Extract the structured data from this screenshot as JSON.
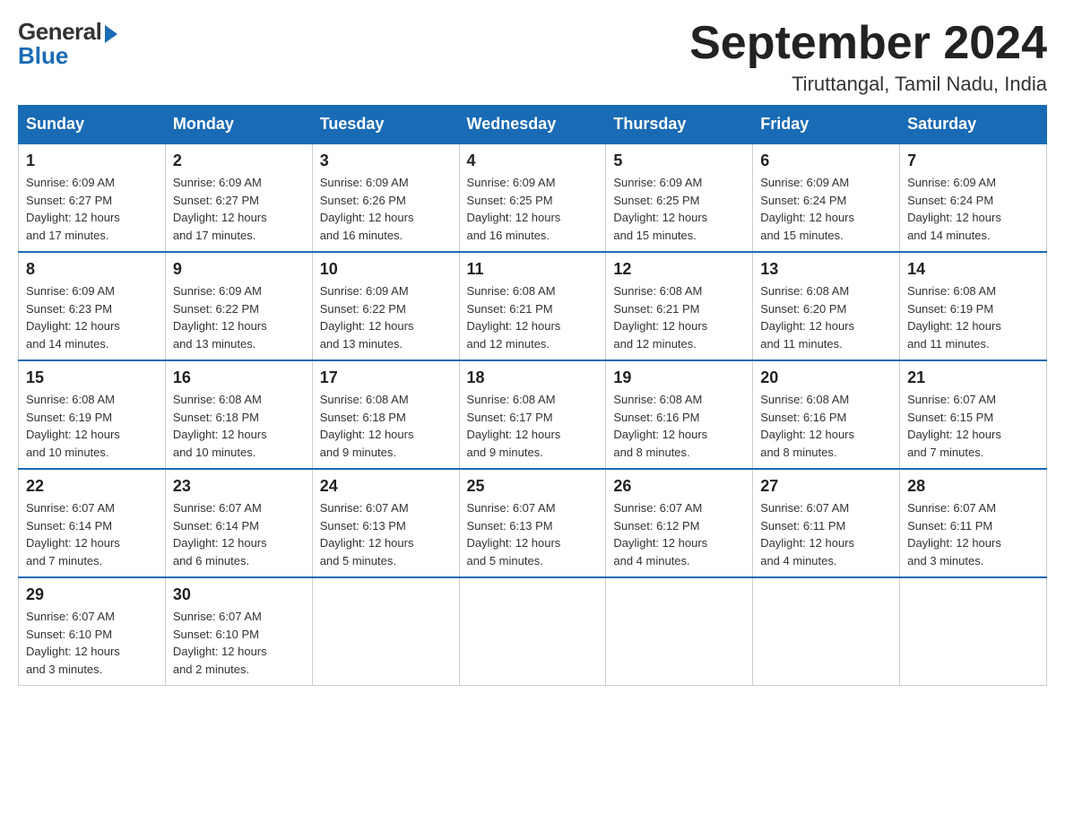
{
  "logo": {
    "general": "General",
    "blue": "Blue"
  },
  "header": {
    "title": "September 2024",
    "subtitle": "Tiruttangal, Tamil Nadu, India"
  },
  "weekdays": [
    "Sunday",
    "Monday",
    "Tuesday",
    "Wednesday",
    "Thursday",
    "Friday",
    "Saturday"
  ],
  "weeks": [
    [
      {
        "day": "1",
        "sunrise": "6:09 AM",
        "sunset": "6:27 PM",
        "daylight": "12 hours and 17 minutes."
      },
      {
        "day": "2",
        "sunrise": "6:09 AM",
        "sunset": "6:27 PM",
        "daylight": "12 hours and 17 minutes."
      },
      {
        "day": "3",
        "sunrise": "6:09 AM",
        "sunset": "6:26 PM",
        "daylight": "12 hours and 16 minutes."
      },
      {
        "day": "4",
        "sunrise": "6:09 AM",
        "sunset": "6:25 PM",
        "daylight": "12 hours and 16 minutes."
      },
      {
        "day": "5",
        "sunrise": "6:09 AM",
        "sunset": "6:25 PM",
        "daylight": "12 hours and 15 minutes."
      },
      {
        "day": "6",
        "sunrise": "6:09 AM",
        "sunset": "6:24 PM",
        "daylight": "12 hours and 15 minutes."
      },
      {
        "day": "7",
        "sunrise": "6:09 AM",
        "sunset": "6:24 PM",
        "daylight": "12 hours and 14 minutes."
      }
    ],
    [
      {
        "day": "8",
        "sunrise": "6:09 AM",
        "sunset": "6:23 PM",
        "daylight": "12 hours and 14 minutes."
      },
      {
        "day": "9",
        "sunrise": "6:09 AM",
        "sunset": "6:22 PM",
        "daylight": "12 hours and 13 minutes."
      },
      {
        "day": "10",
        "sunrise": "6:09 AM",
        "sunset": "6:22 PM",
        "daylight": "12 hours and 13 minutes."
      },
      {
        "day": "11",
        "sunrise": "6:08 AM",
        "sunset": "6:21 PM",
        "daylight": "12 hours and 12 minutes."
      },
      {
        "day": "12",
        "sunrise": "6:08 AM",
        "sunset": "6:21 PM",
        "daylight": "12 hours and 12 minutes."
      },
      {
        "day": "13",
        "sunrise": "6:08 AM",
        "sunset": "6:20 PM",
        "daylight": "12 hours and 11 minutes."
      },
      {
        "day": "14",
        "sunrise": "6:08 AM",
        "sunset": "6:19 PM",
        "daylight": "12 hours and 11 minutes."
      }
    ],
    [
      {
        "day": "15",
        "sunrise": "6:08 AM",
        "sunset": "6:19 PM",
        "daylight": "12 hours and 10 minutes."
      },
      {
        "day": "16",
        "sunrise": "6:08 AM",
        "sunset": "6:18 PM",
        "daylight": "12 hours and 10 minutes."
      },
      {
        "day": "17",
        "sunrise": "6:08 AM",
        "sunset": "6:18 PM",
        "daylight": "12 hours and 9 minutes."
      },
      {
        "day": "18",
        "sunrise": "6:08 AM",
        "sunset": "6:17 PM",
        "daylight": "12 hours and 9 minutes."
      },
      {
        "day": "19",
        "sunrise": "6:08 AM",
        "sunset": "6:16 PM",
        "daylight": "12 hours and 8 minutes."
      },
      {
        "day": "20",
        "sunrise": "6:08 AM",
        "sunset": "6:16 PM",
        "daylight": "12 hours and 8 minutes."
      },
      {
        "day": "21",
        "sunrise": "6:07 AM",
        "sunset": "6:15 PM",
        "daylight": "12 hours and 7 minutes."
      }
    ],
    [
      {
        "day": "22",
        "sunrise": "6:07 AM",
        "sunset": "6:14 PM",
        "daylight": "12 hours and 7 minutes."
      },
      {
        "day": "23",
        "sunrise": "6:07 AM",
        "sunset": "6:14 PM",
        "daylight": "12 hours and 6 minutes."
      },
      {
        "day": "24",
        "sunrise": "6:07 AM",
        "sunset": "6:13 PM",
        "daylight": "12 hours and 5 minutes."
      },
      {
        "day": "25",
        "sunrise": "6:07 AM",
        "sunset": "6:13 PM",
        "daylight": "12 hours and 5 minutes."
      },
      {
        "day": "26",
        "sunrise": "6:07 AM",
        "sunset": "6:12 PM",
        "daylight": "12 hours and 4 minutes."
      },
      {
        "day": "27",
        "sunrise": "6:07 AM",
        "sunset": "6:11 PM",
        "daylight": "12 hours and 4 minutes."
      },
      {
        "day": "28",
        "sunrise": "6:07 AM",
        "sunset": "6:11 PM",
        "daylight": "12 hours and 3 minutes."
      }
    ],
    [
      {
        "day": "29",
        "sunrise": "6:07 AM",
        "sunset": "6:10 PM",
        "daylight": "12 hours and 3 minutes."
      },
      {
        "day": "30",
        "sunrise": "6:07 AM",
        "sunset": "6:10 PM",
        "daylight": "12 hours and 2 minutes."
      },
      null,
      null,
      null,
      null,
      null
    ]
  ],
  "labels": {
    "sunrise": "Sunrise:",
    "sunset": "Sunset:",
    "daylight": "Daylight:"
  }
}
